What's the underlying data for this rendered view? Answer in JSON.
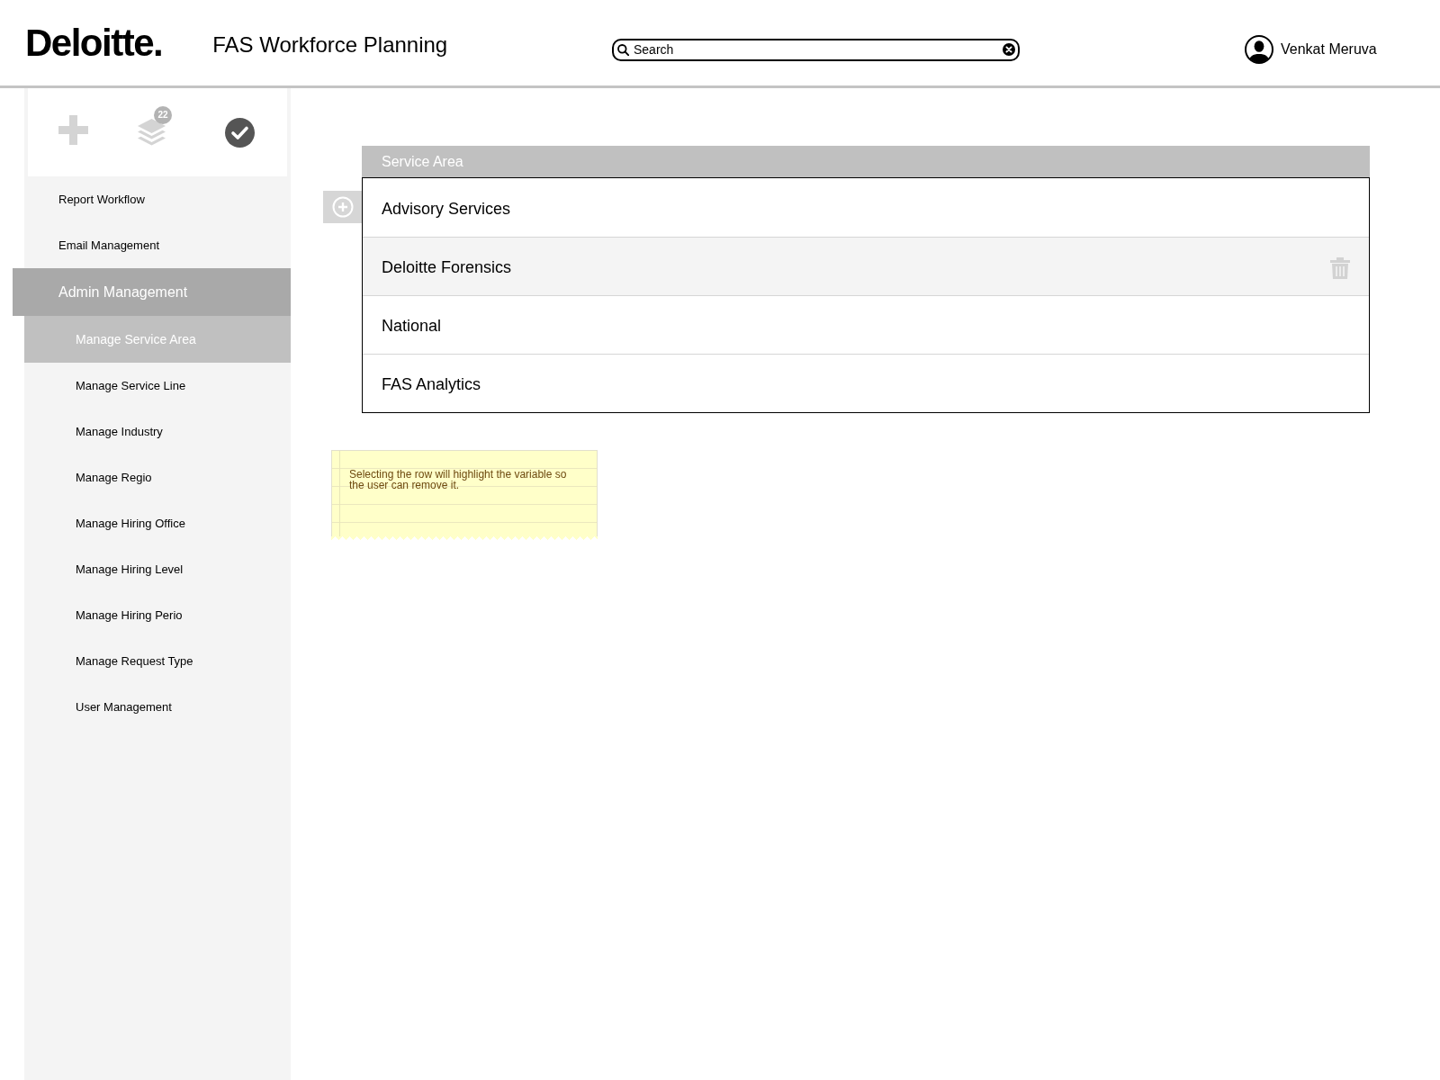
{
  "header": {
    "logo": "Deloitte.",
    "title": "FAS Workforce Planning",
    "search": {
      "placeholder": "Search"
    },
    "user": {
      "name": "Venkat Meruva"
    }
  },
  "sidebar": {
    "toolbar_badge": "22",
    "items": [
      {
        "label": "Report Workflow",
        "selected": false
      },
      {
        "label": "Email Management",
        "selected": false
      },
      {
        "label": "Admin Management",
        "selected": true,
        "children": [
          {
            "label": "Manage Service Area",
            "selected": true
          },
          {
            "label": "Manage Service Line",
            "selected": false
          },
          {
            "label": "Manage Industry",
            "selected": false
          },
          {
            "label": "Manage Regio",
            "selected": false
          },
          {
            "label": "Manage Hiring Office",
            "selected": false
          },
          {
            "label": "Manage Hiring Level",
            "selected": false
          },
          {
            "label": "Manage Hiring Perio",
            "selected": false
          },
          {
            "label": "Manage Request Type",
            "selected": false
          },
          {
            "label": "User Management",
            "selected": false
          }
        ]
      }
    ]
  },
  "table": {
    "columns": [
      "Service Area"
    ],
    "rows": [
      {
        "cells": [
          "Advisory Services"
        ],
        "selected": false
      },
      {
        "cells": [
          "Deloitte Forensics"
        ],
        "selected": true
      },
      {
        "cells": [
          "National"
        ],
        "selected": false
      },
      {
        "cells": [
          "FAS Analytics"
        ],
        "selected": false
      }
    ]
  },
  "note": {
    "text": "Selecting the row will highlight the variable so the user can remove it."
  }
}
